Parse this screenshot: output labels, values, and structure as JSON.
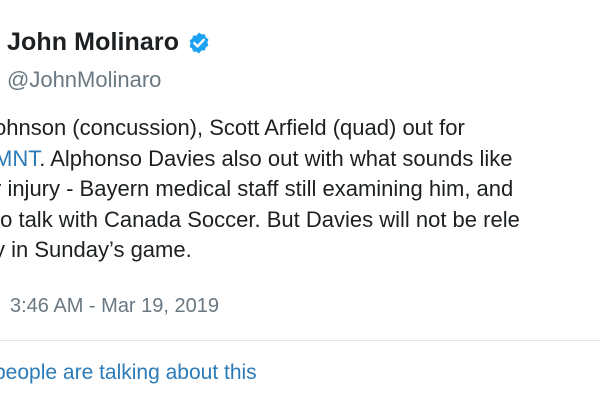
{
  "author": {
    "name": "John Molinaro",
    "handle": "@JohnMolinaro",
    "verified_icon": "verified-badge-icon",
    "verified_color": "#1da1f2"
  },
  "tweet": {
    "line1": "ohnson (concussion), Scott Arfield (quad) out for",
    "line2_link": "MNT",
    "line2_rest": ". Alphonso Davies also out with what sounds like",
    "line3": "r injury - Bayern medical staff still examining him, and",
    "line4": "to talk with Canada Soccer. But Davies will not be rele",
    "line5": "y in Sunday’s game."
  },
  "timestamp": "3:46 AM - Mar 19, 2019",
  "talking_link": "people are talking about this",
  "colors": {
    "text": "#1c2022",
    "secondary": "#697882",
    "link": "#2b7bb9",
    "divider": "#e1e8ed"
  }
}
